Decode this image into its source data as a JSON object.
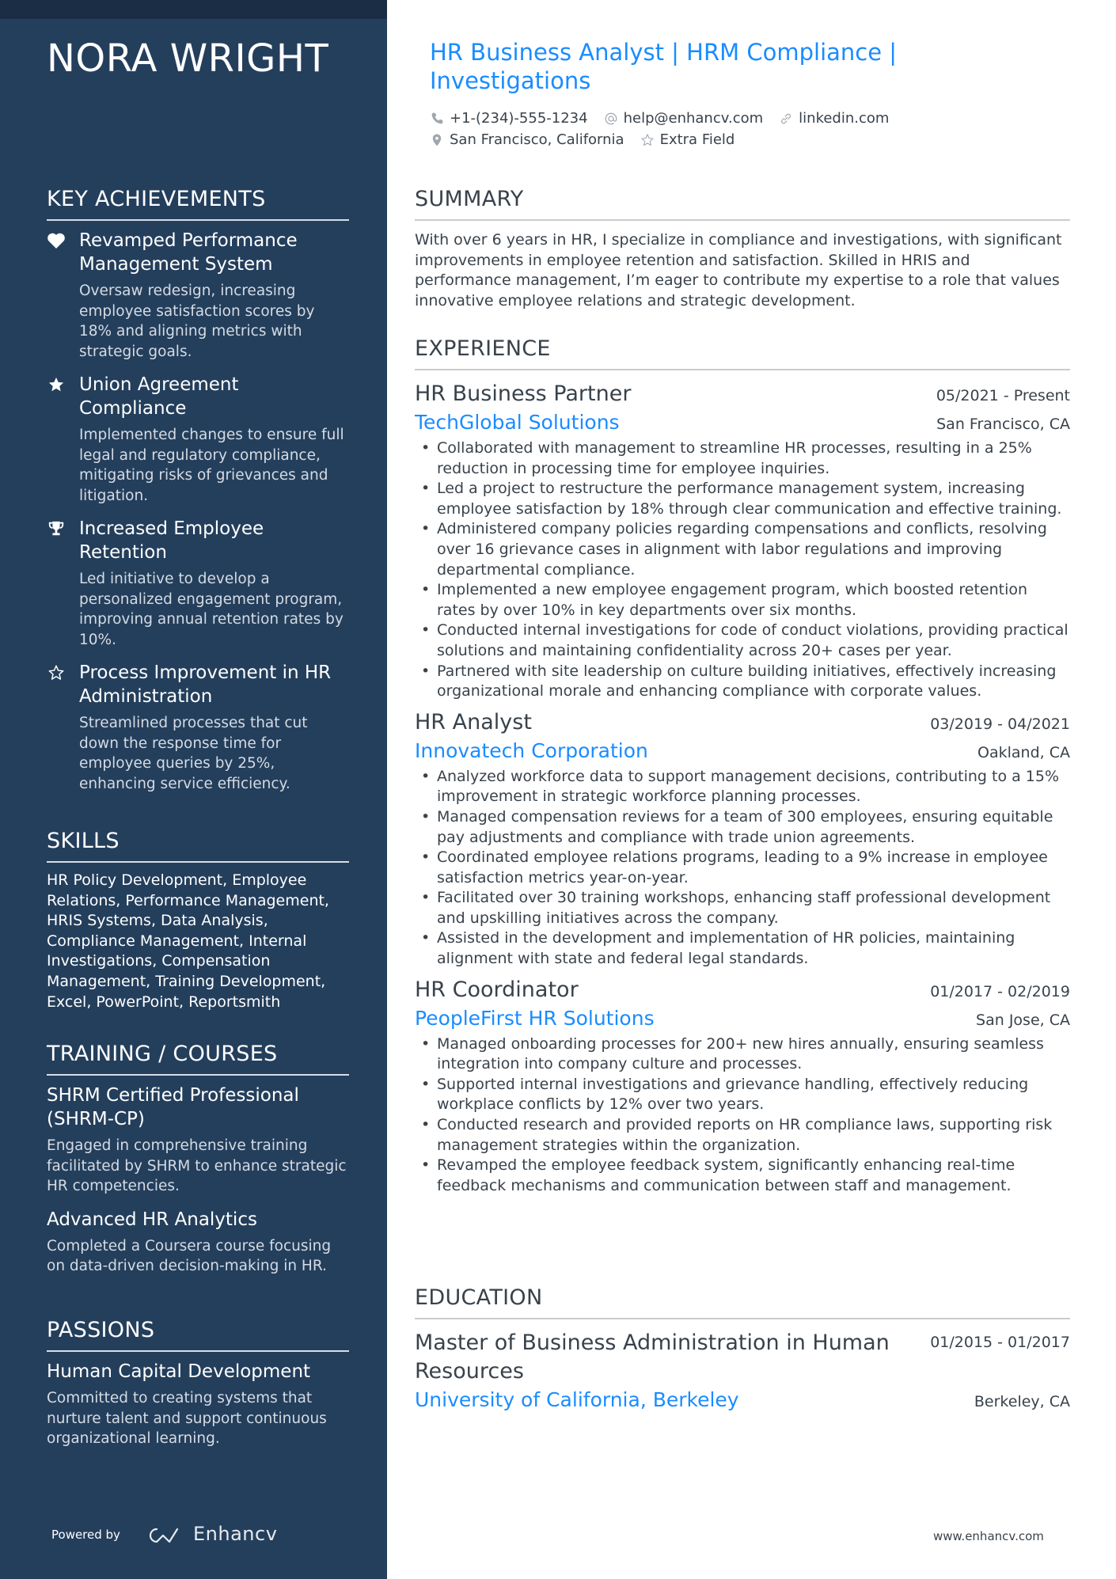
{
  "colors": {
    "sidebar_bg": "#243f5c",
    "sidebar_topband": "#1b2d44",
    "accent": "#1a8cff",
    "text": "#39424b"
  },
  "name": "NORA WRIGHT",
  "title": "HR Business Analyst | HRM Compliance | Investigations",
  "contacts": {
    "phone": {
      "icon": "phone-icon",
      "value": "+1-(234)-555-1234"
    },
    "email": {
      "icon": "at-icon",
      "value": "help@enhancv.com"
    },
    "linkedin": {
      "icon": "link-icon",
      "value": "linkedin.com"
    },
    "location": {
      "icon": "location-pin-icon",
      "value": "San Francisco, California"
    },
    "extra": {
      "icon": "star-outline-icon",
      "value": "Extra Field"
    }
  },
  "sidebar": {
    "achievements": {
      "heading": "KEY ACHIEVEMENTS",
      "items": [
        {
          "icon": "heart-icon",
          "title": "Revamped Performance Management System",
          "desc": "Oversaw redesign, increasing employee satisfaction scores by 18% and aligning metrics with strategic goals."
        },
        {
          "icon": "star-icon",
          "title": "Union Agreement Compliance",
          "desc": "Implemented changes to ensure full legal and regulatory compliance, mitigating risks of grievances and litigation."
        },
        {
          "icon": "trophy-icon",
          "title": "Increased Employee Retention",
          "desc": "Led initiative to develop a personalized engagement program, improving annual retention rates by 10%."
        },
        {
          "icon": "star-outline-icon",
          "title": "Process Improvement in HR Administration",
          "desc": "Streamlined processes that cut down the response time for employee queries by 25%, enhancing service efficiency."
        }
      ]
    },
    "skills": {
      "heading": "SKILLS",
      "text": "HR Policy Development, Employee Relations, Performance Management, HRIS Systems, Data Analysis, Compliance Management, Internal Investigations, Compensation Management, Training Development, Excel, PowerPoint, Reportsmith"
    },
    "training": {
      "heading": "TRAINING / COURSES",
      "items": [
        {
          "title": "SHRM Certified Professional (SHRM-CP)",
          "desc": "Engaged in comprehensive training facilitated by SHRM to enhance strategic HR competencies."
        },
        {
          "title": "Advanced HR Analytics",
          "desc": "Completed a Coursera course focusing on data-driven decision-making in HR."
        }
      ]
    },
    "passions": {
      "heading": "PASSIONS",
      "items": [
        {
          "title": "Human Capital Development",
          "desc": "Committed to creating systems that nurture talent and support continuous organizational learning."
        }
      ]
    },
    "powered_by": "Powered by",
    "brand": "Enhancv"
  },
  "summary": {
    "heading": "SUMMARY",
    "text": "With over 6 years in HR, I specialize in compliance and investigations, with significant improvements in employee retention and satisfaction. Skilled in HRIS and performance management, I’m eager to contribute my expertise to a role that values innovative employee relations and strategic development."
  },
  "experience": {
    "heading": "EXPERIENCE",
    "jobs": [
      {
        "title": "HR Business Partner",
        "date": "05/2021 - Present",
        "company": "TechGlobal Solutions",
        "location": "San Francisco, CA",
        "bullets": [
          "Collaborated with management to streamline HR processes, resulting in a 25% reduction in processing time for employee inquiries.",
          "Led a project to restructure the performance management system, increasing employee satisfaction by 18% through clear communication and effective training.",
          "Administered company policies regarding compensations and conflicts, resolving over 16 grievance cases in alignment with labor regulations and improving departmental compliance.",
          "Implemented a new employee engagement program, which boosted retention rates by over 10% in key departments over six months.",
          "Conducted internal investigations for code of conduct violations, providing practical solutions and maintaining confidentiality across 20+ cases per year.",
          "Partnered with site leadership on culture building initiatives, effectively increasing organizational morale and enhancing compliance with corporate values."
        ]
      },
      {
        "title": "HR Analyst",
        "date": "03/2019 - 04/2021",
        "company": "Innovatech Corporation",
        "location": "Oakland, CA",
        "bullets": [
          "Analyzed workforce data to support management decisions, contributing to a 15% improvement in strategic workforce planning processes.",
          "Managed compensation reviews for a team of 300 employees, ensuring equitable pay adjustments and compliance with trade union agreements.",
          "Coordinated employee relations programs, leading to a 9% increase in employee satisfaction metrics year-on-year.",
          "Facilitated over 30 training workshops, enhancing staff professional development and upskilling initiatives across the company.",
          "Assisted in the development and implementation of HR policies, maintaining alignment with state and federal legal standards."
        ]
      },
      {
        "title": "HR Coordinator",
        "date": "01/2017 - 02/2019",
        "company": "PeopleFirst HR Solutions",
        "location": "San Jose, CA",
        "bullets": [
          "Managed onboarding processes for 200+ new hires annually, ensuring seamless integration into company culture and processes.",
          "Supported internal investigations and grievance handling, effectively reducing workplace conflicts by 12% over two years.",
          "Conducted research and provided reports on HR compliance laws, supporting risk management strategies within the organization.",
          "Revamped the employee feedback system, significantly enhancing real-time feedback mechanisms and communication between staff and management."
        ]
      }
    ]
  },
  "education": {
    "heading": "EDUCATION",
    "items": [
      {
        "degree": "Master of Business Administration in Human Resources",
        "date": "01/2015 - 01/2017",
        "school": "University of California, Berkeley",
        "location": "Berkeley, CA"
      }
    ]
  },
  "footer_url": "www.enhancv.com"
}
